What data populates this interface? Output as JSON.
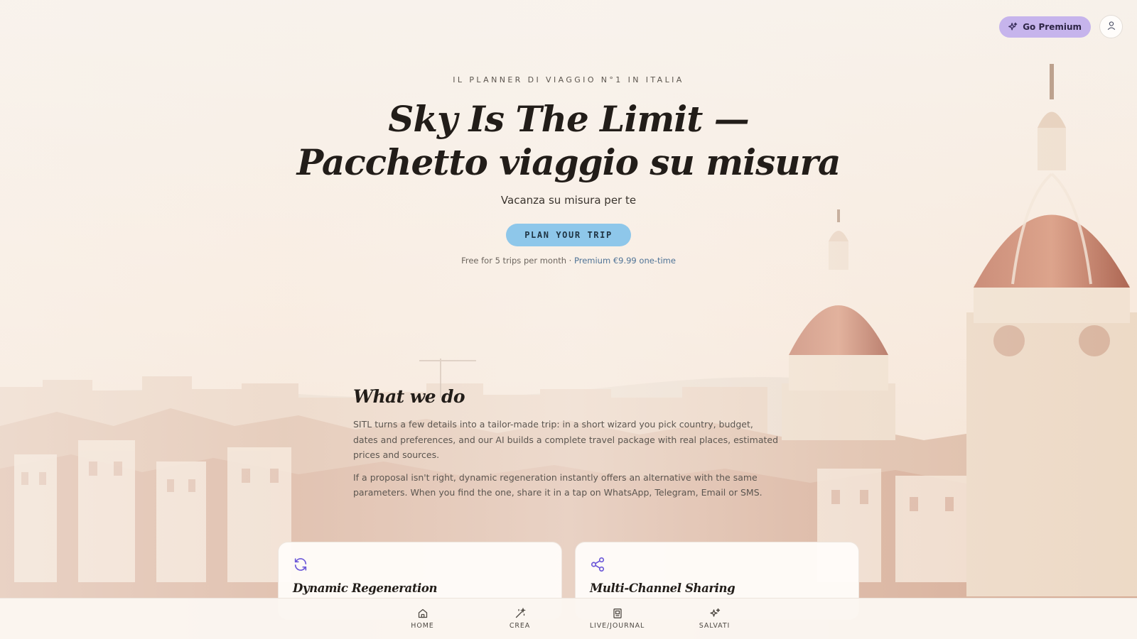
{
  "header": {
    "premium_label": "Go Premium",
    "premium_icon": "sparkles-icon",
    "profile_icon": "user-icon"
  },
  "hero": {
    "eyebrow": "IL PLANNER DI VIAGGIO N°1 IN ITALIA",
    "title_line1": "Sky Is The Limit —",
    "title_line2": "Pacchetto viaggio su misura",
    "subtitle": "Vacanza su misura per te",
    "cta_label": "PLAN YOUR TRIP",
    "pricing_free": "Free for 5 trips per month · ",
    "pricing_premium": "Premium €9.99 one-time"
  },
  "about": {
    "heading": "What we do",
    "paragraph1": "SITL turns a few details into a tailor-made trip: in a short wizard you pick country, budget, dates and preferences, and our AI builds a complete travel package with real places, estimated prices and sources.",
    "paragraph2": "If a proposal isn't right, dynamic regeneration instantly offers an alternative with the same parameters. When you find the one, share it in a tap on WhatsApp, Telegram, Email or SMS."
  },
  "features": [
    {
      "title": "Dynamic Regeneration",
      "icon": "refresh-icon"
    },
    {
      "title": "Multi-Channel Sharing",
      "icon": "share-icon"
    }
  ],
  "nav": [
    {
      "label": "HOME",
      "icon": "home-icon"
    },
    {
      "label": "CREA",
      "icon": "magic-wand-icon"
    },
    {
      "label": "LIVE/JOURNAL",
      "icon": "journal-icon"
    },
    {
      "label": "SALVATI",
      "icon": "sparkles-icon"
    }
  ],
  "colors": {
    "premium_bg": "#c6b4ec",
    "cta_bg": "#8ec7ea",
    "accent_link": "#4f7396",
    "icon_accent": "#6b57d8"
  }
}
